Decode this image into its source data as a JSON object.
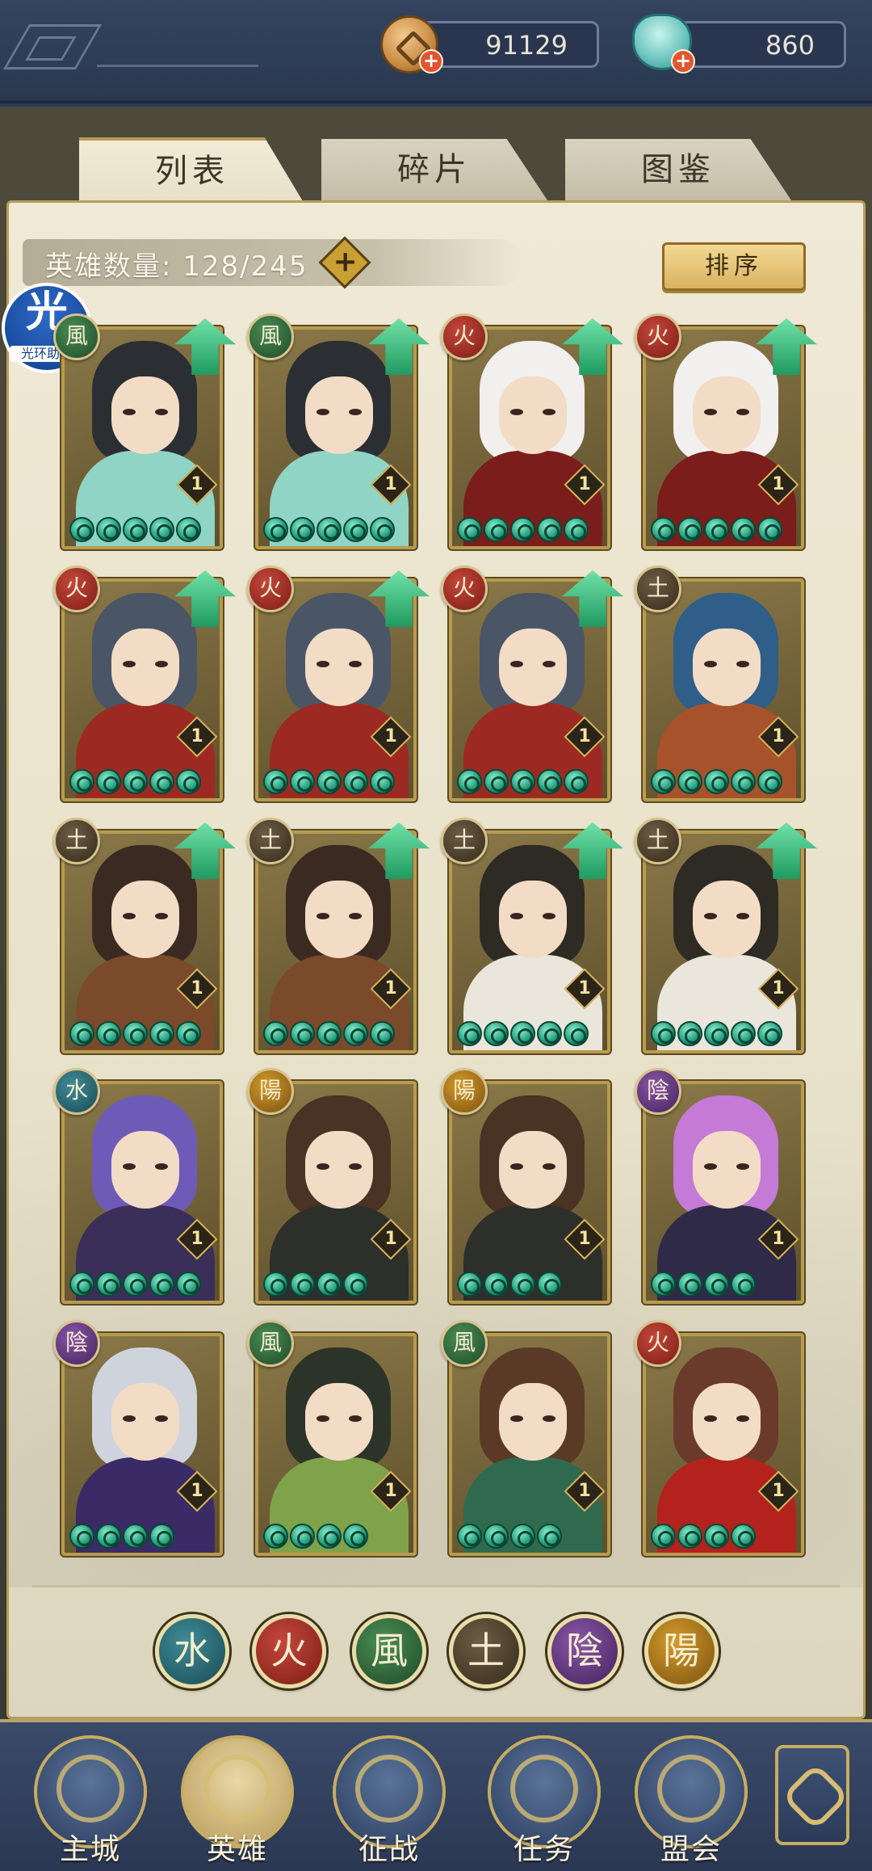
{
  "currency": {
    "coins": "91129",
    "jade": "860",
    "plus": "+"
  },
  "tabs": [
    {
      "label": "列表",
      "active": true
    },
    {
      "label": "碎片",
      "active": false
    },
    {
      "label": "图鉴",
      "active": false
    }
  ],
  "hero_count_label": "英雄数量: 128/245",
  "count_add_glyph": "+",
  "sort_label": "排序",
  "assistant": {
    "glyph": "光",
    "label": "光环助手"
  },
  "heroes": [
    {
      "element": "wind",
      "element_glyph": "風",
      "level": "1",
      "stars": 5,
      "upgrade": true,
      "hair": "#2b2f33",
      "body": "#8fd4c4"
    },
    {
      "element": "wind",
      "element_glyph": "風",
      "level": "1",
      "stars": 5,
      "upgrade": true,
      "hair": "#2b2f33",
      "body": "#8fd4c4"
    },
    {
      "element": "fire",
      "element_glyph": "火",
      "level": "1",
      "stars": 5,
      "upgrade": true,
      "hair": "#f2f0ee",
      "body": "#7b1d1b"
    },
    {
      "element": "fire",
      "element_glyph": "火",
      "level": "1",
      "stars": 5,
      "upgrade": true,
      "hair": "#f2f0ee",
      "body": "#7b1d1b"
    },
    {
      "element": "fire",
      "element_glyph": "火",
      "level": "1",
      "stars": 5,
      "upgrade": true,
      "hair": "#4a5566",
      "body": "#9c2a22"
    },
    {
      "element": "fire",
      "element_glyph": "火",
      "level": "1",
      "stars": 5,
      "upgrade": true,
      "hair": "#4a5566",
      "body": "#9c2a22"
    },
    {
      "element": "fire",
      "element_glyph": "火",
      "level": "1",
      "stars": 5,
      "upgrade": true,
      "hair": "#4a5566",
      "body": "#9c2a22"
    },
    {
      "element": "earth",
      "element_glyph": "土",
      "level": "1",
      "stars": 5,
      "upgrade": false,
      "hair": "#2f5e88",
      "body": "#a8522c"
    },
    {
      "element": "earth",
      "element_glyph": "土",
      "level": "1",
      "stars": 5,
      "upgrade": true,
      "hair": "#3a2a22",
      "body": "#7a4a2a"
    },
    {
      "element": "earth",
      "element_glyph": "土",
      "level": "1",
      "stars": 5,
      "upgrade": true,
      "hair": "#3a2a22",
      "body": "#7a4a2a"
    },
    {
      "element": "earth",
      "element_glyph": "土",
      "level": "1",
      "stars": 5,
      "upgrade": true,
      "hair": "#2e2a24",
      "body": "#eae6dc"
    },
    {
      "element": "earth",
      "element_glyph": "土",
      "level": "1",
      "stars": 5,
      "upgrade": true,
      "hair": "#2e2a24",
      "body": "#eae6dc"
    },
    {
      "element": "water",
      "element_glyph": "水",
      "level": "1",
      "stars": 5,
      "upgrade": false,
      "hair": "#6e5bb8",
      "body": "#3a2f58"
    },
    {
      "element": "yang",
      "element_glyph": "陽",
      "level": "1",
      "stars": 4,
      "upgrade": false,
      "hair": "#4a3224",
      "body": "#2d2f2a"
    },
    {
      "element": "yang",
      "element_glyph": "陽",
      "level": "1",
      "stars": 4,
      "upgrade": false,
      "hair": "#4a3224",
      "body": "#2d2f2a"
    },
    {
      "element": "yin",
      "element_glyph": "陰",
      "level": "1",
      "stars": 4,
      "upgrade": false,
      "hair": "#c47ad6",
      "body": "#2f2a48"
    },
    {
      "element": "yin",
      "element_glyph": "陰",
      "level": "1",
      "stars": 4,
      "upgrade": false,
      "hair": "#cfd3dc",
      "body": "#3a2a66"
    },
    {
      "element": "wind",
      "element_glyph": "風",
      "level": "1",
      "stars": 4,
      "upgrade": false,
      "hair": "#2c3328",
      "body": "#7fa34a"
    },
    {
      "element": "wind",
      "element_glyph": "風",
      "level": "1",
      "stars": 4,
      "upgrade": false,
      "hair": "#5a3a26",
      "body": "#2f6a4e"
    },
    {
      "element": "fire",
      "element_glyph": "火",
      "level": "1",
      "stars": 4,
      "upgrade": false,
      "hair": "#6a3a2a",
      "body": "#b3221c"
    }
  ],
  "filters": [
    {
      "element": "water",
      "glyph": "水"
    },
    {
      "element": "fire",
      "glyph": "火"
    },
    {
      "element": "wind",
      "glyph": "風"
    },
    {
      "element": "earth",
      "glyph": "土"
    },
    {
      "element": "yin",
      "glyph": "陰"
    },
    {
      "element": "yang",
      "glyph": "陽"
    }
  ],
  "nav": [
    {
      "label": "主城",
      "icon": "city-gate-icon",
      "active": false
    },
    {
      "label": "英雄",
      "icon": "hero-portrait-icon",
      "active": true
    },
    {
      "label": "征战",
      "icon": "battle-helmet-icon",
      "active": false
    },
    {
      "label": "任务",
      "icon": "task-bell-icon",
      "active": false
    },
    {
      "label": "盟会",
      "icon": "guild-pavilion-icon",
      "active": false
    }
  ],
  "colors": {
    "accent_gold": "#c6ad62",
    "parchment": "#efe9d6",
    "nav_blue": "#2b3853"
  }
}
